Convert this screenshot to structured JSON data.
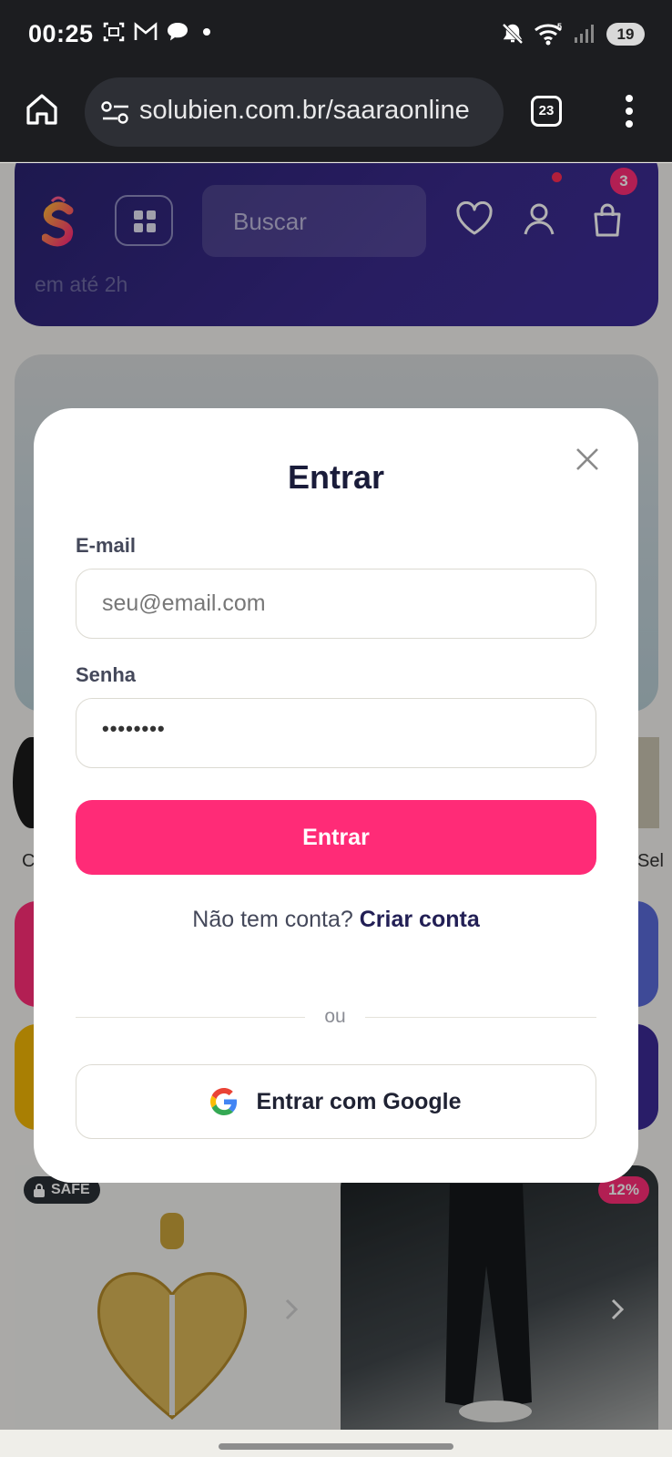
{
  "status_bar": {
    "time": "00:25",
    "battery": "19"
  },
  "browser": {
    "url": "solubien.com.br/saaraonline",
    "tab_count": "23"
  },
  "site_header": {
    "search_placeholder": "Buscar",
    "cart_count": "3",
    "subtitle": "em até 2h"
  },
  "background": {
    "category_left_label": "C",
    "category_right_label": "Sel",
    "product_badge_safe": "SAFE",
    "product_discount": "12%"
  },
  "modal": {
    "title": "Entrar",
    "email_label": "E-mail",
    "email_placeholder": "seu@email.com",
    "password_label": "Senha",
    "password_value": "••••••••",
    "submit_label": "Entrar",
    "no_account_text": "Não tem conta?",
    "create_account_link": "Criar conta",
    "divider_text": "ou",
    "google_label": "Entrar com Google"
  },
  "colors": {
    "primary": "#ff2b77",
    "header_bg": "#2a2370",
    "link": "#221f55"
  }
}
